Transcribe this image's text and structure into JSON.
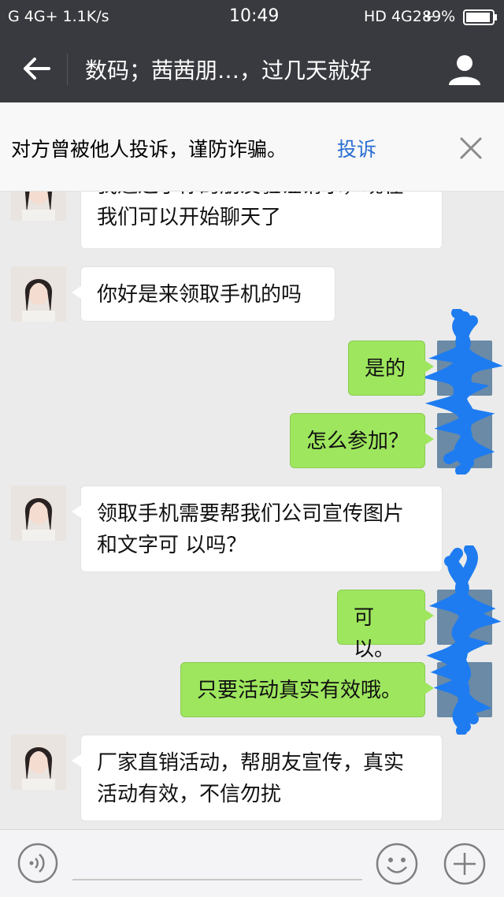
{
  "status_bar": {
    "left": "G 4G+ 1.1K/s",
    "time": "10:49",
    "right_network": "HD 4G2+",
    "battery": "89%"
  },
  "header": {
    "title": "数码；茜茜朋…，过几天就好"
  },
  "warning": {
    "text": "对方曾被他人投诉，谨防诈骗。",
    "link": "投诉"
  },
  "messages": [
    {
      "from": "them",
      "lines": [
        "我通过了你的朋友验证请求，现在",
        "我们可以开始聊天了"
      ]
    },
    {
      "from": "them",
      "lines": [
        "你好是来领取手机的吗"
      ]
    },
    {
      "from": "me",
      "lines": [
        "是的"
      ]
    },
    {
      "from": "me",
      "lines": [
        "怎么参加？"
      ]
    },
    {
      "from": "them",
      "lines": [
        "领取手机需要帮我们公司宣传图片",
        "和文字可 以吗？"
      ]
    },
    {
      "from": "me",
      "lines": [
        "可以。"
      ]
    },
    {
      "from": "me",
      "lines": [
        "只要活动真实有效哦。"
      ]
    },
    {
      "from": "them",
      "lines": [
        "厂家直销活动，帮朋友宣传，真实",
        "活动有效，不信勿扰"
      ]
    }
  ],
  "colors": {
    "nav_bg": "#393a3f",
    "chat_bg": "#ebebeb",
    "bubble_out": "#9ee65e",
    "bubble_in": "#ffffff",
    "link": "#2a6fd3",
    "redaction": "#1e7cf0"
  },
  "icons": {
    "back": "arrow-left-icon",
    "profile": "person-icon",
    "close": "close-icon",
    "voice": "voice-icon",
    "emoji": "emoji-icon",
    "more": "plus-icon"
  }
}
